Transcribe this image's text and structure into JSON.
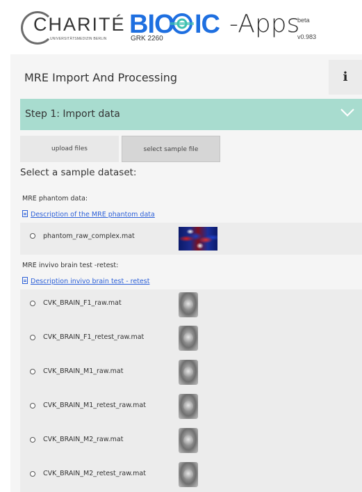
{
  "header": {
    "charite": "CHARITÉ",
    "charite_sub": "UNIVERSITÄTSMEDIZIN BERLIN",
    "bioqic_left": "BIO",
    "bioqic_right": "IC",
    "grk": "GRK 2260",
    "apps": "-Apps",
    "beta": "beta",
    "version": "v0.983"
  },
  "panel": {
    "title": "MRE Import And Processing",
    "info_label": "i",
    "step_label": "Step 1: Import data",
    "tabs": [
      {
        "label": "upload files"
      },
      {
        "label": "select sample file"
      }
    ],
    "select_heading": "Select a sample dataset:"
  },
  "groups": [
    {
      "label": "MRE phantom data:",
      "link": "Description of the MRE phantom data",
      "options": [
        {
          "label": "phantom_raw_complex.mat",
          "thumb": "phantom"
        }
      ]
    },
    {
      "label": "MRE invivo brain test -retest:",
      "link": "Description invivo brain test - retest",
      "options": [
        {
          "label": "CVK_BRAIN_F1_raw.mat",
          "thumb": "brain"
        },
        {
          "label": "CVK_BRAIN_F1_retest_raw.mat",
          "thumb": "brain"
        },
        {
          "label": "CVK_BRAIN_M1_raw.mat",
          "thumb": "brain"
        },
        {
          "label": "CVK_BRAIN_M1_retest_raw.mat",
          "thumb": "brain"
        },
        {
          "label": "CVK_BRAIN_M2_raw.mat",
          "thumb": "brain"
        },
        {
          "label": "CVK_BRAIN_M2_retest_raw.mat",
          "thumb": "brain"
        }
      ]
    }
  ],
  "colors": {
    "step_bar": "#a8dccf",
    "brand_blue": "#1e6fe0",
    "link_blue": "#2b5fd8"
  }
}
